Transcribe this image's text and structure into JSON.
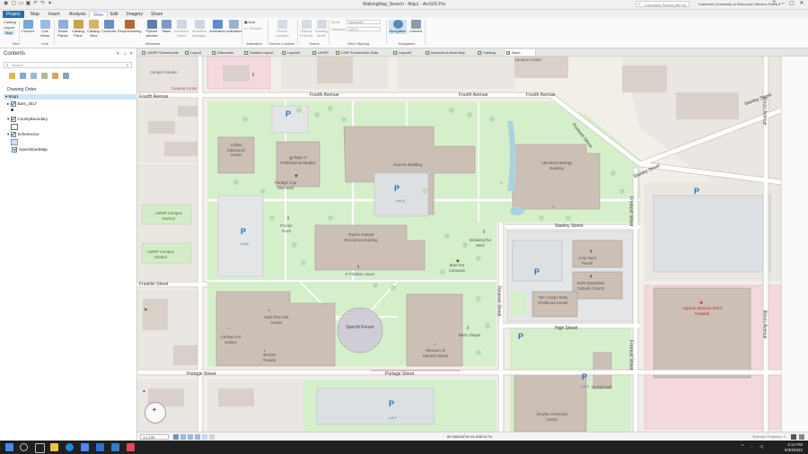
{
  "app": {
    "title": "WalkingMap_Search - Map1 - ArcGIS Pro",
    "command_search_placeholder": "Command Search (Alt+Q)",
    "user": "Katherine (University of Wisconsin Stevens Point) ▾"
  },
  "ribbon_tabs": [
    "Project",
    "Map",
    "Insert",
    "Analysis",
    "View",
    "Edit",
    "Imagery",
    "Share"
  ],
  "ribbon": {
    "view_group": {
      "items": [
        "Catalog",
        "Layout",
        "Map"
      ],
      "label": "View"
    },
    "link_group": {
      "items": [
        "Convert",
        "Link Views",
        "Reset Panes",
        "Catalog Pane",
        "Catalog View",
        "Contents",
        "Geoprocessing",
        "Python window",
        "Tasks",
        "Windows Styles",
        "Workflow Manager",
        "Animation",
        "Indicators"
      ],
      "label": "Link",
      "windows_label": "Windows"
    },
    "animation_group": {
      "items": [
        "Add",
        "Timeline"
      ],
      "label": "Animation"
    },
    "device_group": {
      "items": [
        "Device Location"
      ],
      "label": "Device Location"
    },
    "scene_group": {
      "items": [
        "Objects Property",
        "Drawing Mode"
      ],
      "label": "Scene"
    },
    "clipping_group": {
      "mode_label": "Mode",
      "mode_value": "Automatic",
      "distance_label": "Distance",
      "distance_value": "100 ft",
      "label": "View Clipping"
    },
    "navigation_group": {
      "items": [
        "Navigation",
        "Camera"
      ],
      "label": "Navigation"
    }
  },
  "contents": {
    "title": "Contents",
    "search_placeholder": "Search",
    "drawing_order": "Drawing Order",
    "map_name": "Map1",
    "layers": [
      "Bars_2017",
      "CountyBoundary",
      "Schemector",
      "OpenStreetMap"
    ]
  },
  "view_tabs": [
    "UWSP Schmeeckle",
    "Layout",
    "Wisconsin",
    "Sundial Layout",
    "Layout2",
    "UWSP",
    "CNR Schmeeckle Data",
    "Layout3",
    "Impervious Area Map",
    "Catalog",
    "Map1"
  ],
  "map": {
    "roads": {
      "fourth_ave_left": "Fourth Avenue",
      "fourth_ave_mid": "Fourth Avenue",
      "fourth_ave_right": "Fourth Avenue",
      "fourth_ave_top": "Fourth Avenue",
      "fremont_diag": "Fremont Street",
      "fremont_vert": "Fremont Street",
      "fremont_vert2": "Fremont Street",
      "stanley_diag": "Stanley Street",
      "stanley_right": "Stanley Street",
      "stanley_mid": "Stanley Street",
      "franklin": "Franklin Street",
      "reserve": "Reserve Street",
      "high": "High Street",
      "portage_left": "Portage Street",
      "portage_mid": "Portage Street",
      "illinois": "Illinois Avenue",
      "illinois2": "Illinois Avenue"
    },
    "buildings": {
      "collins": "Collins Classroom Center",
      "cps": "College of Professional Studies",
      "science": "Science Building",
      "chemistry": "Chemistry Biology Building",
      "trainer": "Trainer Natural Resources Building",
      "noel": "Noel Fine Arts Center",
      "carlsten": "Carlsten Art Gallery",
      "jenkins": "Jenkins Theatre",
      "specht": "Specht Forum",
      "museum": "Museum of Natural History",
      "holy_spirit": "Holy Spirit Parish",
      "st_stanislaus": "Saint Stanislaus Catholic Church",
      "copps": "Tom Copps Early Childhood Center",
      "hospital": "Aspirus Stevens Point Hospital",
      "delzell": "Delzell Hall",
      "dreyfus": "Dreyfus University Center",
      "campus_center": "Campus Center",
      "new_center": "Campus Center"
    },
    "pois": {
      "pride_rock": "Pointer Rock",
      "breaking_mold": "Breaking the Mold",
      "rhapsody": "Blue Dot Compass",
      "placeholder": "Portage Cup Memorial",
      "sundial": "E Pluribus Unum",
      "brick": "Brick Chapel",
      "uwsp_nursery": "UWSP Campus Nursery",
      "uwsp_garden": "UWSP Campus Garden",
      "campus_garden_top": "Campus Garden"
    },
    "lots": {
      "lot_q": "Lot Q",
      "lot_e": "Lot E",
      "lot_t": "Lot T",
      "lot_z": "Lot Z",
      "lot_p": "P",
      "lot_p2": "P",
      "lot_p3": "P",
      "lot_p4": "P",
      "lot_p5": "P",
      "lot_p6": "P",
      "lot_p7": "P",
      "lot_p8": "P"
    }
  },
  "status": {
    "scale": "1:1,720",
    "coordinates": "89.5654467W 44.5282117N",
    "selected": "Selected Features: 0"
  },
  "taskbar": {
    "time": "4:14 PM",
    "date": "6/30/2022"
  }
}
